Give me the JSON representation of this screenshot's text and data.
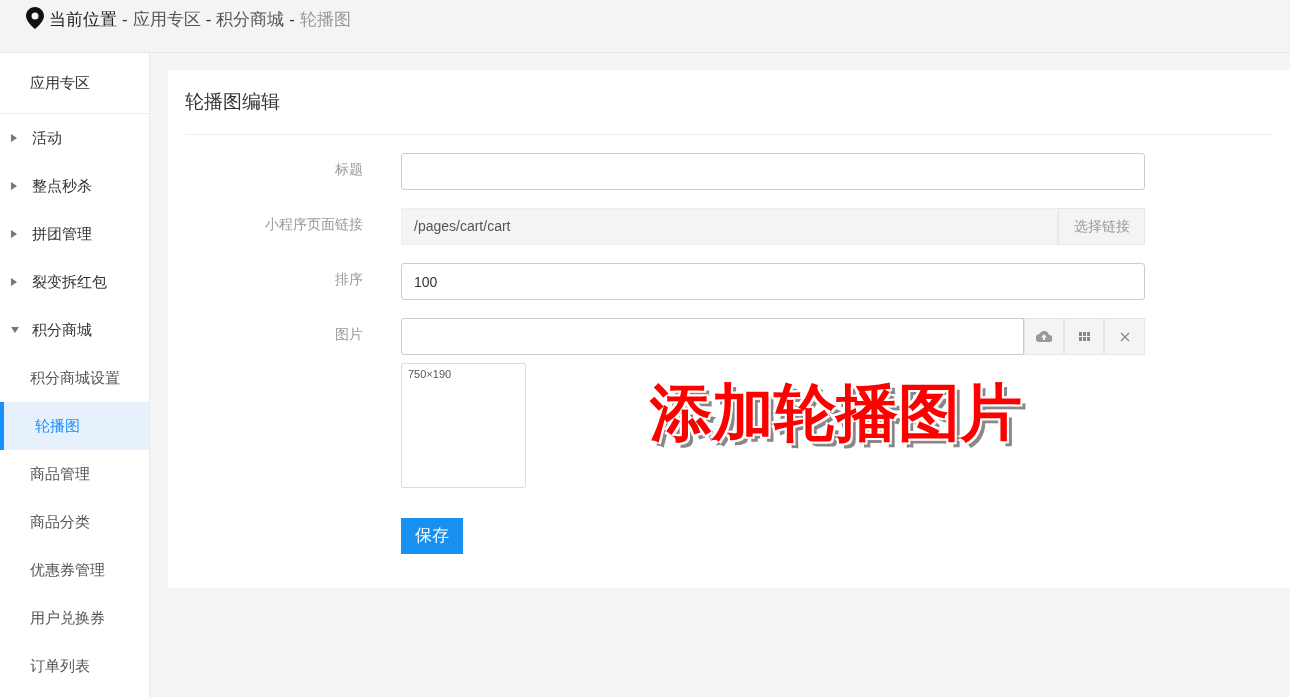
{
  "breadcrumb": {
    "label": "当前位置",
    "separator": "-",
    "items": [
      "应用专区",
      "积分商城"
    ],
    "current": "轮播图"
  },
  "sidebar": {
    "title": "应用专区",
    "items": [
      {
        "label": "活动",
        "expanded": false
      },
      {
        "label": "整点秒杀",
        "expanded": false
      },
      {
        "label": "拼团管理",
        "expanded": false
      },
      {
        "label": "裂变拆红包",
        "expanded": false
      },
      {
        "label": "积分商城",
        "expanded": true,
        "children": [
          {
            "label": "积分商城设置",
            "selected": false
          },
          {
            "label": "轮播图",
            "selected": true
          },
          {
            "label": "商品管理",
            "selected": false
          },
          {
            "label": "商品分类",
            "selected": false
          },
          {
            "label": "优惠券管理",
            "selected": false
          },
          {
            "label": "用户兑换券",
            "selected": false
          },
          {
            "label": "订单列表",
            "selected": false
          }
        ]
      }
    ]
  },
  "panel": {
    "title": "轮播图编辑",
    "fields": [
      {
        "kind": "text",
        "label": "标题"
      },
      {
        "kind": "link",
        "label": "小程序页面链接",
        "value": "/pages/cart/cart",
        "button": "选择链接"
      },
      {
        "kind": "text",
        "label": "排序",
        "value": "100"
      },
      {
        "kind": "image",
        "label": "图片",
        "thumbnail": "750×190"
      }
    ],
    "save": "保存",
    "annotation": "添加轮播图片"
  }
}
